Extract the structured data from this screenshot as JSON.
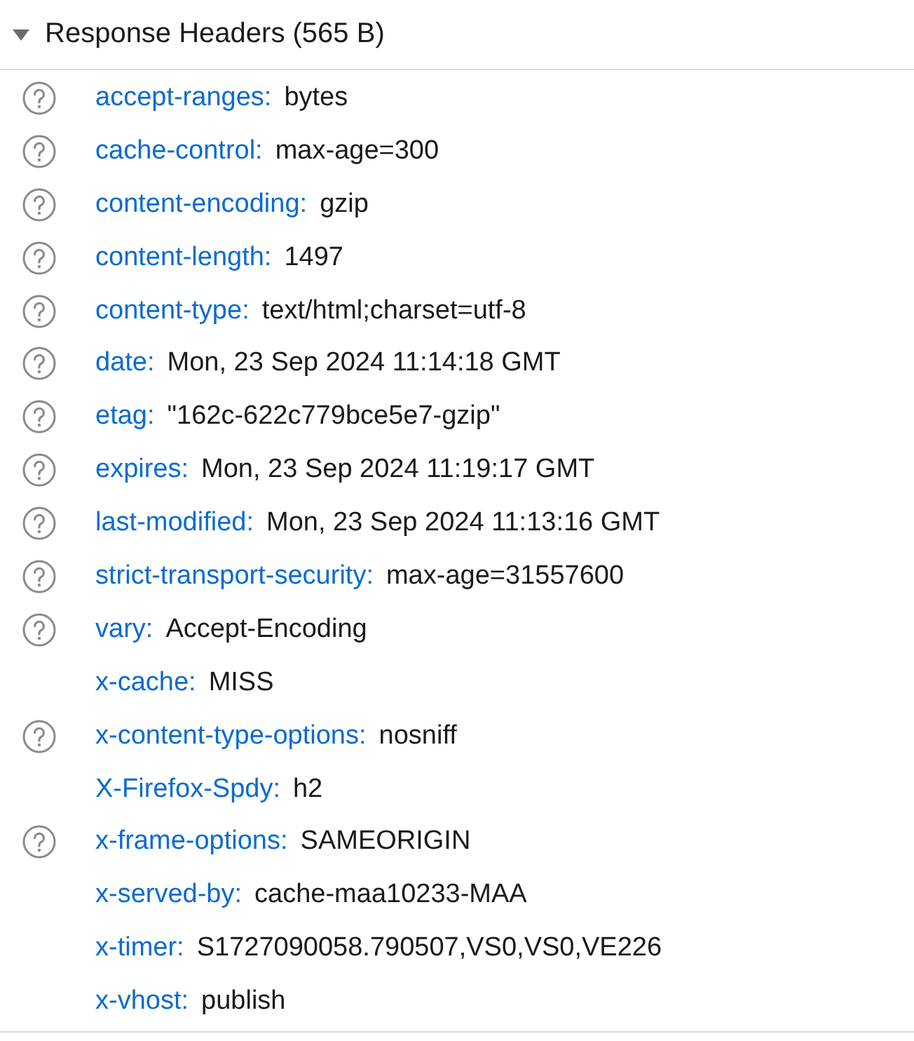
{
  "section": {
    "title": "Response Headers (565 B)",
    "expanded": true
  },
  "headers": [
    {
      "name": "accept-ranges:",
      "value": "bytes",
      "help": true
    },
    {
      "name": "cache-control:",
      "value": "max-age=300",
      "help": true
    },
    {
      "name": "content-encoding:",
      "value": "gzip",
      "help": true
    },
    {
      "name": "content-length:",
      "value": "1497",
      "help": true
    },
    {
      "name": "content-type:",
      "value": "text/html;charset=utf-8",
      "help": true
    },
    {
      "name": "date:",
      "value": "Mon, 23 Sep 2024 11:14:18 GMT",
      "help": true
    },
    {
      "name": "etag:",
      "value": "\"162c-622c779bce5e7-gzip\"",
      "help": true
    },
    {
      "name": "expires:",
      "value": "Mon, 23 Sep 2024 11:19:17 GMT",
      "help": true
    },
    {
      "name": "last-modified:",
      "value": "Mon, 23 Sep 2024 11:13:16 GMT",
      "help": true
    },
    {
      "name": "strict-transport-security:",
      "value": "max-age=31557600",
      "help": true
    },
    {
      "name": "vary:",
      "value": "Accept-Encoding",
      "help": true
    },
    {
      "name": "x-cache:",
      "value": "MISS",
      "help": false
    },
    {
      "name": "x-content-type-options:",
      "value": "nosniff",
      "help": true
    },
    {
      "name": "X-Firefox-Spdy:",
      "value": "h2",
      "help": false
    },
    {
      "name": "x-frame-options:",
      "value": "SAMEORIGIN",
      "help": true
    },
    {
      "name": "x-served-by:",
      "value": "cache-maa10233-MAA",
      "help": false
    },
    {
      "name": "x-timer:",
      "value": "S1727090058.790507,VS0,VS0,VE226",
      "help": false
    },
    {
      "name": "x-vhost:",
      "value": "publish",
      "help": false
    }
  ]
}
